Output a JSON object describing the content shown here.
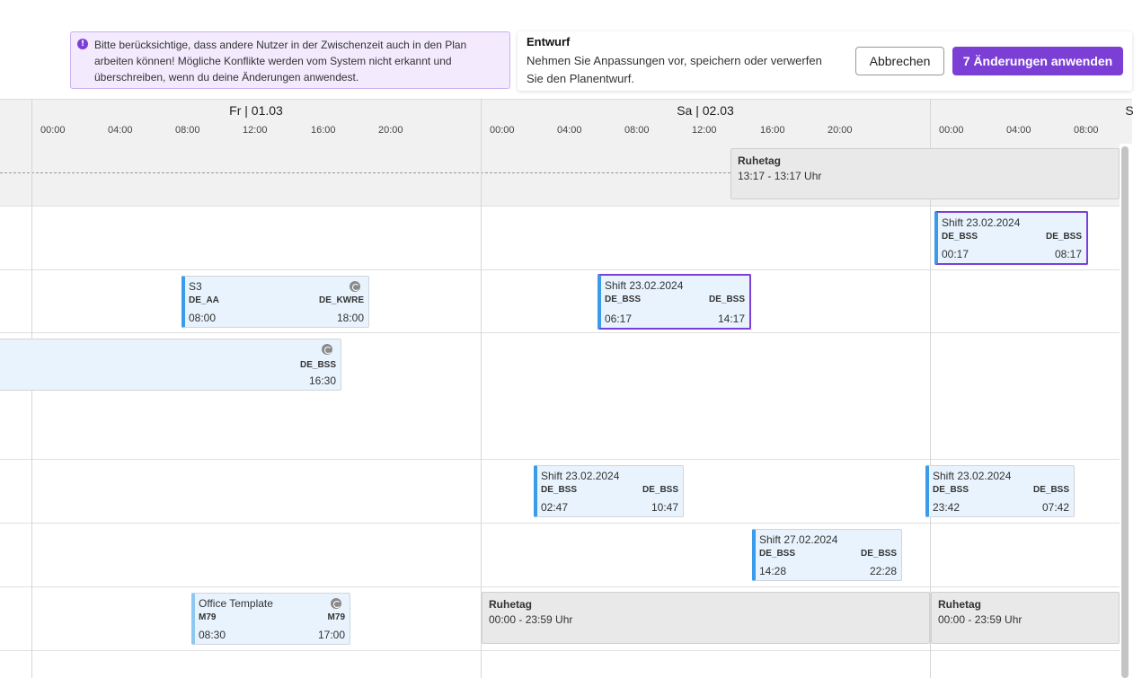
{
  "notice": {
    "icon": "alert-icon",
    "text": "Bitte berücksichtige, dass andere Nutzer in der Zwischenzeit auch in den Plan arbeiten können! Mögliche Konflikte werden vom System nicht erkannt und überschreiben, wenn du deine Änderungen anwendest."
  },
  "draft": {
    "title": "Entwurf",
    "text": "Nehmen Sie Anpassungen vor, speichern oder verwerfen Sie den Planentwurf.",
    "cancel_label": "Abbrechen",
    "apply_label": "7 Änderungen anwenden",
    "accent": "#7b3fd6"
  },
  "timeline": {
    "days": [
      "Fr | 01.03",
      "Sa | 02.03",
      "S"
    ],
    "hours": [
      "00:00",
      "04:00",
      "08:00",
      "12:00",
      "16:00",
      "20:00"
    ]
  },
  "rest_days": [
    {
      "title": "Ruhetag",
      "time": "13:17 - 13:17 Uhr"
    },
    {
      "title": "Ruhetag",
      "time": "00:00 - 23:59 Uhr"
    },
    {
      "title": "Ruhetag",
      "time": "00:00 - 23:59 Uhr"
    }
  ],
  "shifts": [
    {
      "title": "Shift 23.02.2024",
      "from_code": "DE_BSS",
      "to_code": "DE_BSS",
      "start": "00:17",
      "end": "08:17"
    },
    {
      "title": "S3",
      "from_code": "DE_AA",
      "to_code": "DE_KWRE",
      "start": "08:00",
      "end": "18:00"
    },
    {
      "title": "Shift 23.02.2024",
      "from_code": "DE_BSS",
      "to_code": "DE_BSS",
      "start": "06:17",
      "end": "14:17"
    },
    {
      "title": "",
      "from_code": "",
      "to_code": "DE_BSS",
      "start": "",
      "end": "16:30"
    },
    {
      "title": "Shift 23.02.2024",
      "from_code": "DE_BSS",
      "to_code": "DE_BSS",
      "start": "02:47",
      "end": "10:47"
    },
    {
      "title": "Shift 23.02.2024",
      "from_code": "DE_BSS",
      "to_code": "DE_BSS",
      "start": "23:42",
      "end": "07:42"
    },
    {
      "title": "Shift 27.02.2024",
      "from_code": "DE_BSS",
      "to_code": "DE_BSS",
      "start": "14:28",
      "end": "22:28"
    },
    {
      "title": "Office Template",
      "from_code": "M79",
      "to_code": "M79",
      "start": "08:30",
      "end": "17:00"
    }
  ]
}
